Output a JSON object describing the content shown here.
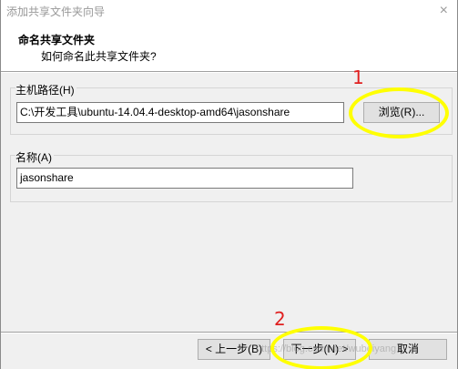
{
  "window": {
    "title": "添加共享文件夹向导",
    "close_glyph": "×"
  },
  "header": {
    "title": "命名共享文件夹",
    "subtitle": "如何命名此共享文件夹?"
  },
  "host_path": {
    "label": "主机路径(H)",
    "value": "C:\\开发工具\\ubuntu-14.04.4-desktop-amd64\\jasonshare",
    "browse_label": "浏览(R)..."
  },
  "name": {
    "label": "名称(A)",
    "value": "jasonshare"
  },
  "footer": {
    "back_label": "< 上一步(B)",
    "next_label": "下一步(N) >",
    "cancel_label": "取消"
  },
  "watermark": "https://blog.csdn.net/wubeiyang",
  "annotations": {
    "mark_1": "1",
    "mark_2": "2",
    "highlight_color": "#ffff00",
    "number_color": "#e02020"
  },
  "colors": {
    "dialog_bg": "#f0f0f0",
    "button_bg": "#e1e1e1",
    "button_border": "#adadad"
  }
}
